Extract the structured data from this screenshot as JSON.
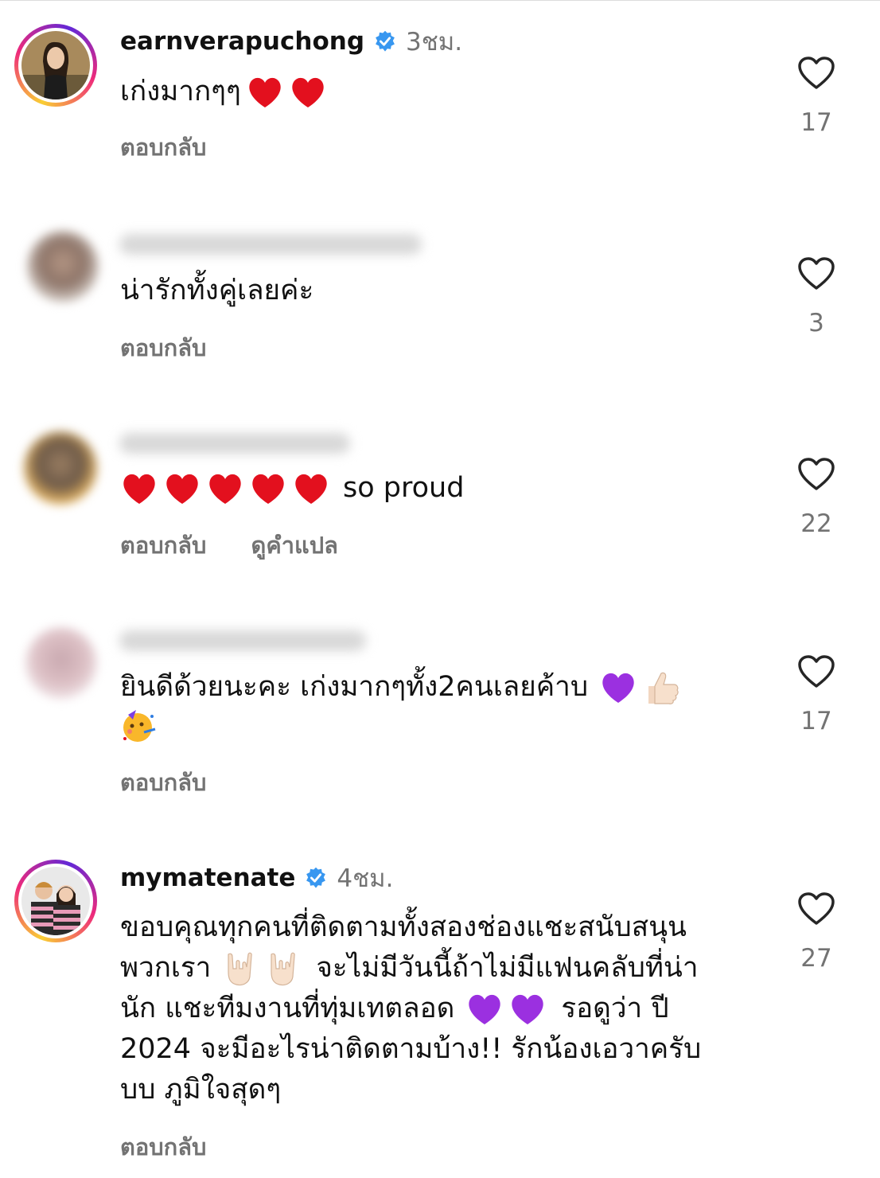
{
  "reply_label": "ตอบกลับ",
  "translate_label": "ดูคำแปล",
  "comments": [
    {
      "username": "earnverapuchong",
      "verified": true,
      "time": "3ชม.",
      "text": "เก่งมากๆๆ",
      "text_emojis": [
        "red-heart",
        "red-heart"
      ],
      "likes": "17"
    },
    {
      "username_visible": false,
      "text": "น่ารักทั้งคู่เลยค่ะ",
      "likes": "3"
    },
    {
      "username_visible": false,
      "text_emojis_before": [
        "red-heart",
        "red-heart",
        "red-heart",
        "red-heart",
        "red-heart"
      ],
      "text": "so proud",
      "likes": "22"
    },
    {
      "username_visible": false,
      "text_line1": "ยินดีด้วยนะคะ เก่งมากๆทั้ง2คนเลยค้าบ",
      "line1_emojis": [
        "purple-heart",
        "thumbs-up"
      ],
      "line2_emojis": [
        "partying-face"
      ],
      "likes": "17"
    },
    {
      "username": "mymatenate",
      "verified": true,
      "time": "4ชม.",
      "lines": [
        "ขอบคุณทุกคนที่ติดตามทั้งสองช่องแชะสนับสนุน",
        "พวกเรา",
        "จะไม่มีวันนี้ถ้าไม่มีแฟนคลับที่น่า",
        "นัก แชะทีมงานที่ทุ่มเทตลอด",
        "รอดูว่า ปี",
        "2024 จะมีอะไรน่าติดตามบ้าง!! รักน้องเอวาครับ",
        "บบ ภูมิใจสุดๆ"
      ],
      "likes": "27"
    }
  ],
  "colors": {
    "verified": "#3897f0",
    "secondary": "#737373",
    "heart_outline": "#262626"
  }
}
